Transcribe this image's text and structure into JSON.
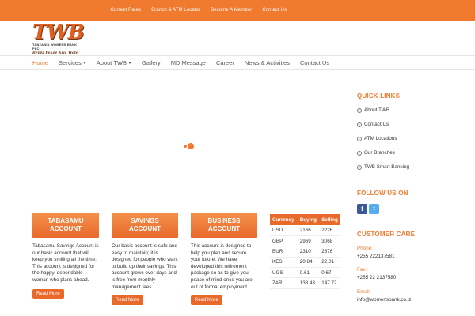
{
  "topbar": {
    "links": [
      "Current Rates",
      "Branch & ATM Locator",
      "Become A Member",
      "Contact Us"
    ]
  },
  "logo": {
    "mark": "TWB",
    "bank_name": "TANZANIA WOMENS BANK PLC",
    "slogan": "Benki Pekee Kwa Wote"
  },
  "nav": {
    "items": [
      {
        "label": "Home",
        "active": true,
        "dropdown": false
      },
      {
        "label": "Services",
        "active": false,
        "dropdown": true
      },
      {
        "label": "About TWB",
        "active": false,
        "dropdown": true
      },
      {
        "label": "Gallery",
        "active": false,
        "dropdown": false
      },
      {
        "label": "MD Message",
        "active": false,
        "dropdown": false
      },
      {
        "label": "Career",
        "active": false,
        "dropdown": false
      },
      {
        "label": "News & Activities",
        "active": false,
        "dropdown": false
      },
      {
        "label": "Contact Us",
        "active": false,
        "dropdown": false
      }
    ]
  },
  "products": [
    {
      "line1": "TABASAMU",
      "line2": "ACCOUNT",
      "description": "Tabasamu Savings Account is our basic account that will keep you smiling all the time. This account is designed for the happy, dependable woman who plans ahead.",
      "button": "Read More"
    },
    {
      "line1": "SAVINGS",
      "line2": "ACCOUNT",
      "description": "Our basic account is safe and easy to maintain; it is designed for people who want to build up their savings. This account grows over days and is free from monthly management fees.",
      "button": "Read More"
    },
    {
      "line1": "BUSINESS",
      "line2": "ACCOUNT",
      "description": "This account is designed to help you plan and secure your future. We have developed this retirement package so as to give you peace of mind once you are out of formal employment.",
      "button": "Read More"
    }
  ],
  "rates": {
    "headers": [
      "Currency",
      "Buying",
      "Selling"
    ],
    "rows": [
      [
        "USD",
        "2166",
        "2226"
      ],
      [
        "GBP",
        "2969",
        "3068"
      ],
      [
        "EUR",
        "2310",
        "2676"
      ],
      [
        "KES",
        "20.84",
        "22.01"
      ],
      [
        "UGS",
        "0.61",
        "0.67"
      ],
      [
        "ZAR",
        "138.43",
        "147.72"
      ]
    ]
  },
  "sidebar": {
    "quick_links_title": "QUICK LINKS",
    "quick_links": [
      "About TWB",
      "Contact Us",
      "ATM Locations",
      "Our Branches",
      "TWB Smart Banking"
    ],
    "follow_title": "FOLLOW US ON",
    "social_icons": [
      "facebook-icon",
      "twitter-icon"
    ],
    "care_title": "CUSTOMER CARE",
    "phone_label": "Phone:",
    "phone": "+255 222137581",
    "fax_label": "Fax:",
    "fax": "+255 22 2137580",
    "email_label": "Email:",
    "email": "info@womensbank.co.tz"
  },
  "colors": {
    "brand_orange": "#f07a2d",
    "button_orange": "#e8692a"
  }
}
